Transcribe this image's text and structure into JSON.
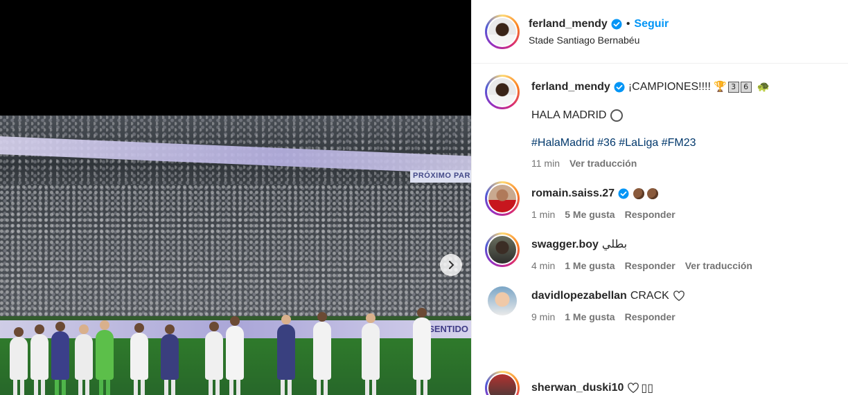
{
  "media": {
    "board_text": "PRÓXIMO PAR",
    "ad_text": "DE SENTIDO"
  },
  "post": {
    "author": "ferland_mendy",
    "follow_label": "Seguir",
    "separator": "•",
    "location": "Stade Santiago Bernabéu"
  },
  "caption": {
    "username": "ferland_mendy",
    "text": "¡CAMPIONES!!!!",
    "emoji_trophy": "🏆",
    "num1": "3",
    "num2": "6",
    "emoji_turtle": "🐢",
    "line2": "HALA MADRID",
    "hashtags": "#HalaMadrid #36 #LaLiga #FM23",
    "time": "11 min",
    "translate": "Ver traducción"
  },
  "comments": [
    {
      "username": "romain.saiss.27",
      "text": "",
      "time": "1 min",
      "likes": "5 Me gusta",
      "reply": "Responder",
      "translate": ""
    },
    {
      "username": "swagger.boy",
      "text": "بطلي",
      "time": "4 min",
      "likes": "1 Me gusta",
      "reply": "Responder",
      "translate": "Ver traducción"
    },
    {
      "username": "davidlopezabellan",
      "text": "CRACK",
      "time": "9 min",
      "likes": "1 Me gusta",
      "reply": "Responder",
      "translate": ""
    },
    {
      "username": "sherwan_duski10",
      "text": "▯▯"
    }
  ],
  "colors": {
    "accent": "#0095f6",
    "hashtag": "#00376b",
    "muted": "#737373",
    "verified": "#0095f6"
  },
  "icons": [
    "verified-badge-icon",
    "chevron-right-icon",
    "heart-outline-icon",
    "clapping-hands-icon",
    "trophy-icon",
    "turtle-icon",
    "circle-icon"
  ]
}
